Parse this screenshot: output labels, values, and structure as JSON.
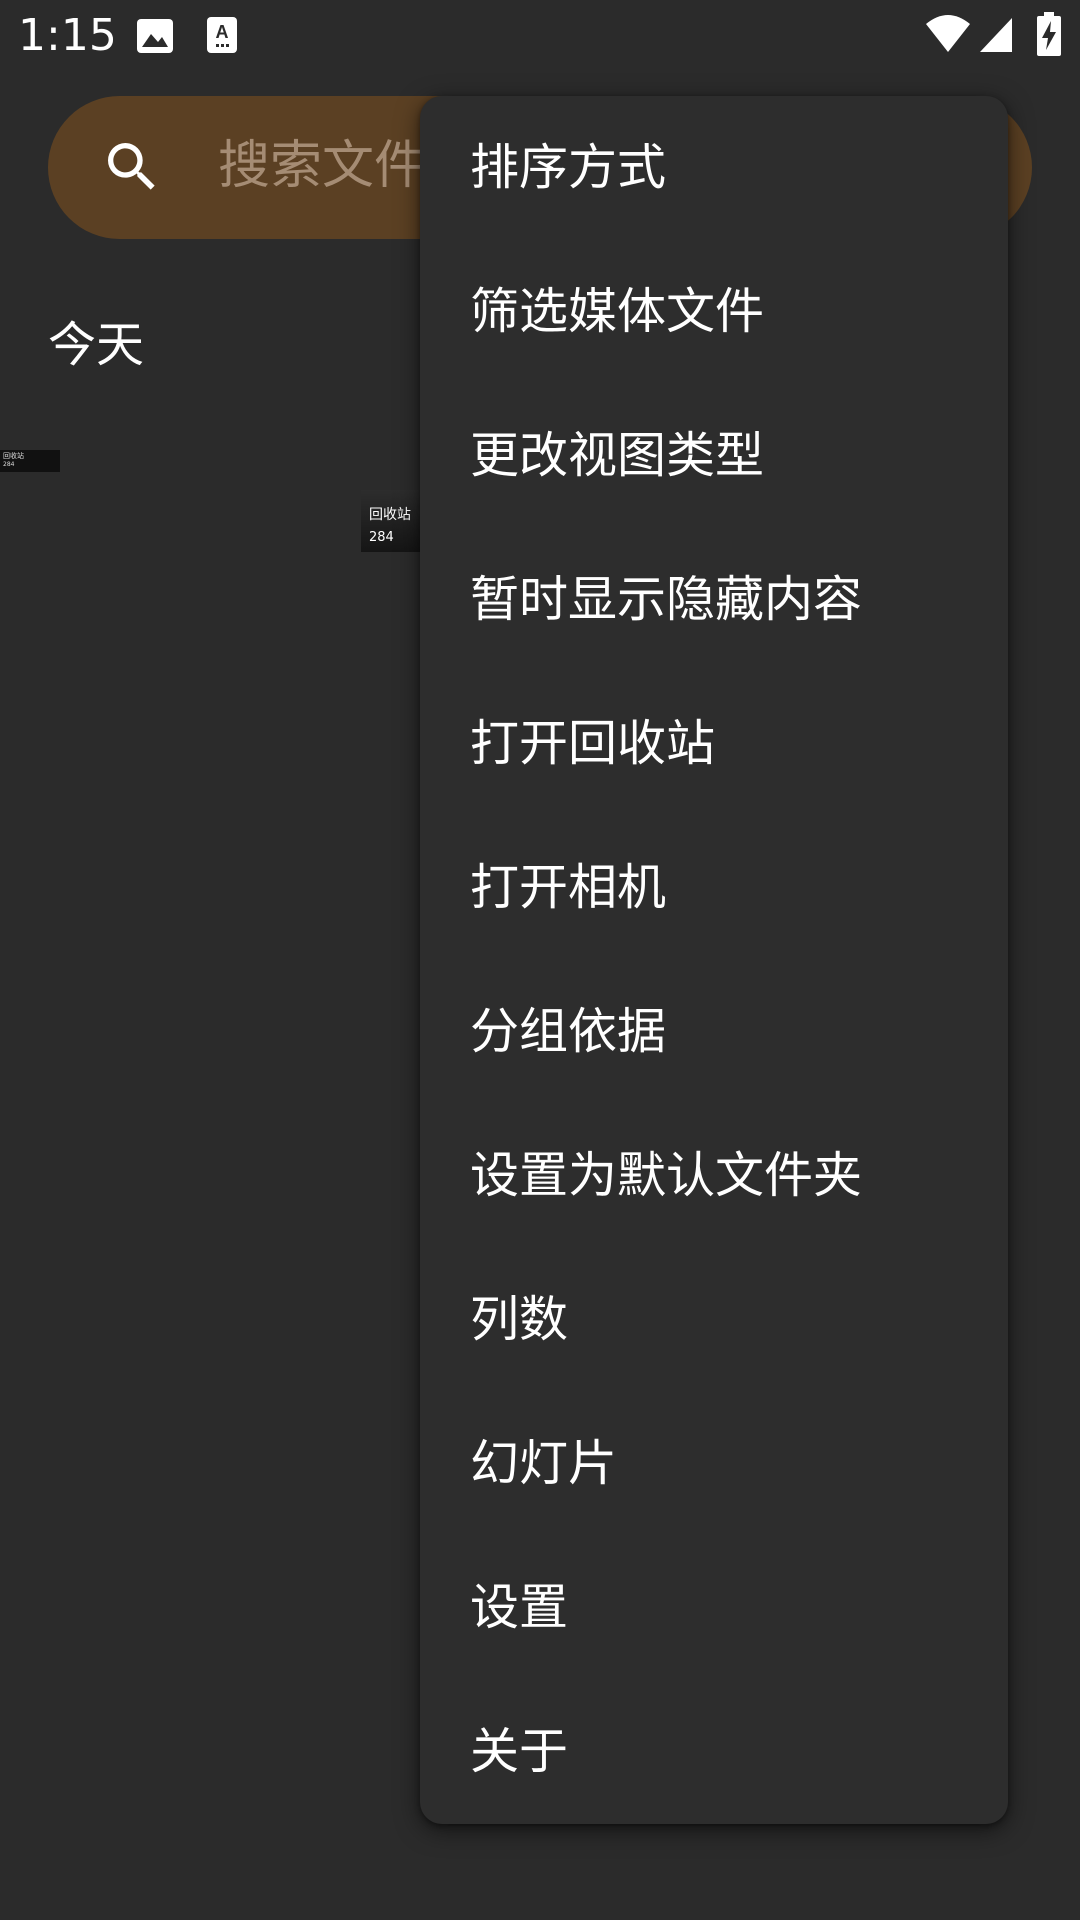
{
  "status_bar": {
    "time": "1:15",
    "icons": [
      "image-icon",
      "text-recognition-icon",
      "wifi-icon",
      "cellular-signal-icon",
      "battery-charging-icon"
    ]
  },
  "search": {
    "placeholder": "搜索文件",
    "accent_color": "#5b4023"
  },
  "gallery": {
    "section_title": "今天",
    "folders": [
      {
        "label": "回收站",
        "count": "284"
      },
      {
        "label": "回收站",
        "count": "284"
      }
    ]
  },
  "menu": {
    "items": [
      {
        "label": "排序方式"
      },
      {
        "label": "筛选媒体文件"
      },
      {
        "label": "更改视图类型"
      },
      {
        "label": "暂时显示隐藏内容"
      },
      {
        "label": "打开回收站"
      },
      {
        "label": "打开相机"
      },
      {
        "label": "分组依据"
      },
      {
        "label": "设置为默认文件夹"
      },
      {
        "label": "列数"
      },
      {
        "label": "幻灯片"
      },
      {
        "label": "设置"
      },
      {
        "label": "关于"
      }
    ]
  }
}
